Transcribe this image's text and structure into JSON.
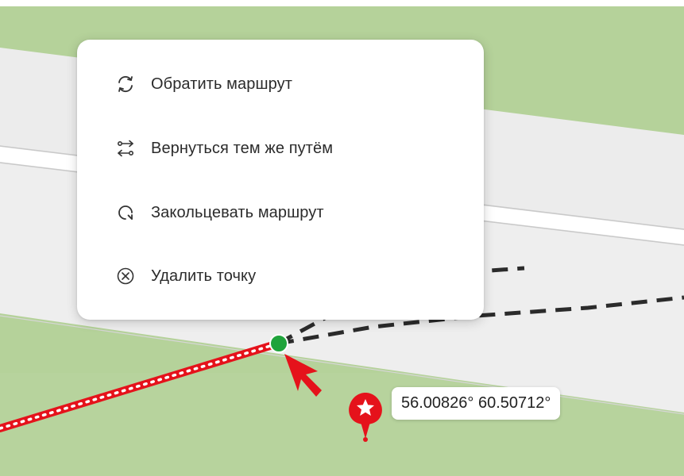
{
  "context_menu": {
    "items": [
      {
        "label": "Обратить маршрут",
        "icon": "reverse-route-icon"
      },
      {
        "label": "Вернуться тем же путём",
        "icon": "return-same-way-icon"
      },
      {
        "label": "Закольцевать маршрут",
        "icon": "loop-route-icon"
      },
      {
        "label": "Удалить точку",
        "icon": "delete-point-icon"
      }
    ]
  },
  "marker": {
    "coordinates": "56.00826° 60.50712°",
    "icon": "star-icon"
  },
  "colors": {
    "map_green": "#b5d29a",
    "road_white": "#f2f2f2",
    "track_red": "#e5121b",
    "route_dashed": "#2b2b2b",
    "waypoint_green": "#1fa33b",
    "pointer_arrow": "#e5121b"
  }
}
